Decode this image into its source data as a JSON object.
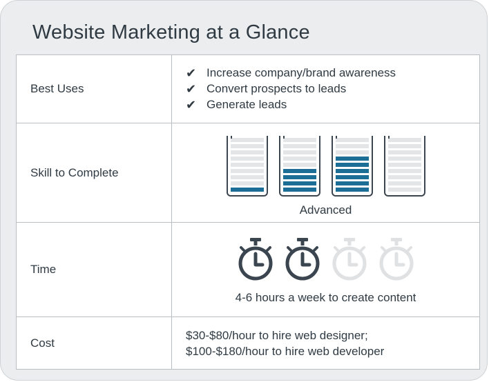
{
  "card": {
    "title": "Website Marketing at a Glance"
  },
  "rows": {
    "best_uses": {
      "label": "Best Uses",
      "items": [
        "Increase company/brand awareness",
        "Convert prospects to leads",
        "Generate leads"
      ],
      "check_glyph": "✔"
    },
    "skill": {
      "label": "Skill to Complete",
      "level_text": "Advanced",
      "meters": [
        {
          "filled": 1,
          "total": 9
        },
        {
          "filled": 4,
          "total": 9
        },
        {
          "filled": 6,
          "total": 9
        },
        {
          "filled": 0,
          "total": 9
        }
      ]
    },
    "time": {
      "label": "Time",
      "text": "4-6 hours a week to create content",
      "timers_active": 2,
      "timers_total": 4
    },
    "cost": {
      "label": "Cost",
      "lines": [
        "$30-$80/hour to hire web designer;",
        "$100-$180/hour to hire web developer"
      ]
    }
  },
  "colors": {
    "accent": "#1d6e96",
    "dark": "#3a4550",
    "muted": "#dfe1e3"
  }
}
